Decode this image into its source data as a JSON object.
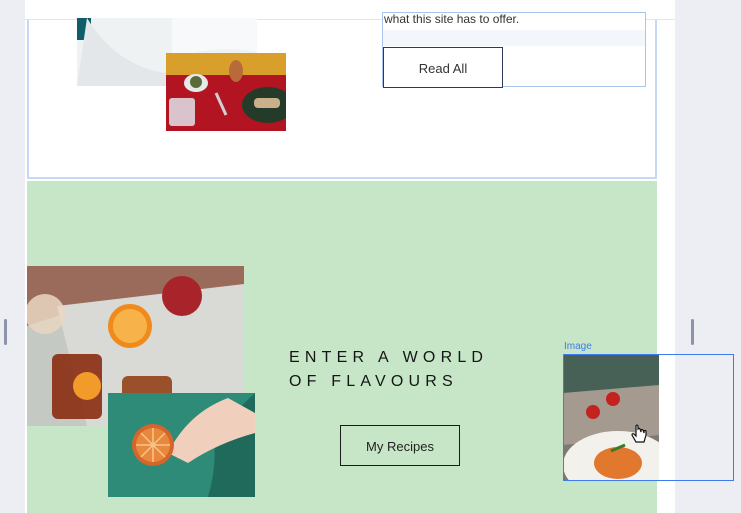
{
  "upper_section": {
    "body_text": "what this site has to offer.",
    "read_all_label": "Read All"
  },
  "green_section": {
    "headline_line1": "ENTER A WORLD",
    "headline_line2": "OF FLAVOURS",
    "recipes_label": "My Recipes"
  },
  "selection": {
    "tag_label": "Image"
  },
  "scrollbar": {
    "up_arrow": "▲"
  },
  "colors": {
    "green_bg": "#c7e6c8",
    "selection_blue": "#3d7cf0"
  }
}
